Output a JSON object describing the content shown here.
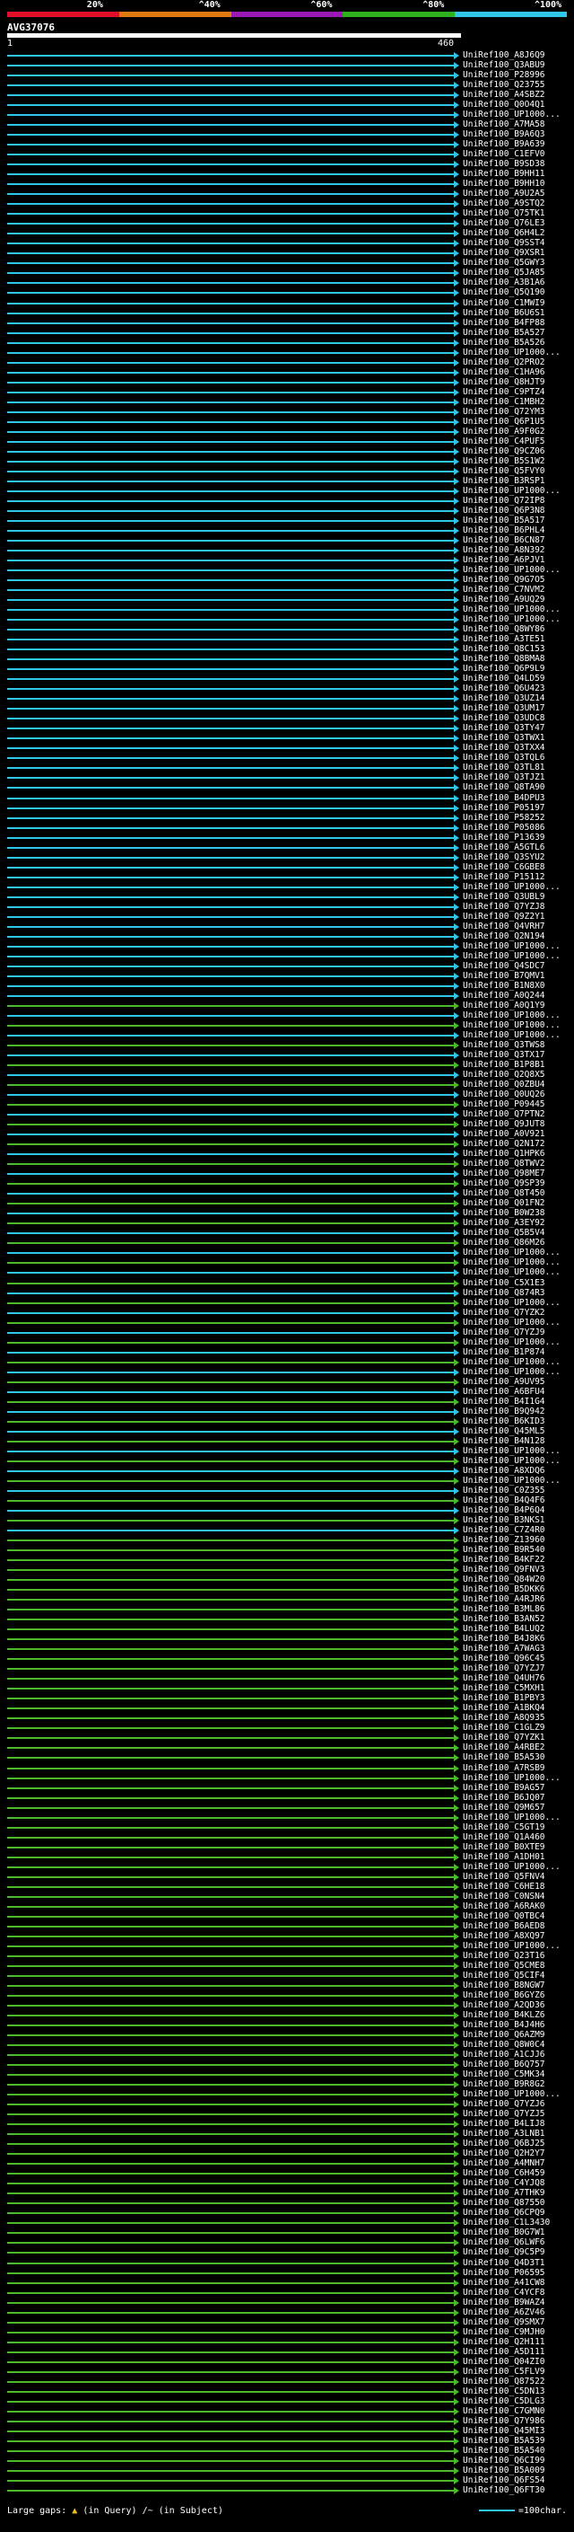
{
  "legend": {
    "labels": [
      "20%",
      "^40%",
      "^60%",
      "^80%",
      "^100%"
    ],
    "colors": [
      "#e0102a",
      "#e07a10",
      "#9a1ab4",
      "#2fb01e",
      "#2fc6e8"
    ]
  },
  "query": {
    "id": "AVG37076",
    "start": "1",
    "end": "460"
  },
  "colors": {
    "high": "#2fc6e8",
    "mid": "#4db82a",
    "low": "#1a3a0a"
  },
  "hits": [
    "UniRef100_A8J6Q9",
    "UniRef100_Q3ABU9",
    "UniRef100_P28996",
    "UniRef100_Q23755",
    "UniRef100_A4SBZ2",
    "UniRef100_Q0O4Q1",
    "UniRef100_UP1000...",
    "UniRef100_A7MA58",
    "UniRef100_B9A6Q3",
    "UniRef100_B9A639",
    "UniRef100_C1EFV0",
    "UniRef100_B9SD38",
    "UniRef100_B9HH11",
    "UniRef100_B9HH10",
    "UniRef100_A9U2A5",
    "UniRef100_A9STQ2",
    "UniRef100_Q75TK1",
    "UniRef100_Q76LE3",
    "UniRef100_Q6H4L2",
    "UniRef100_Q9SST4",
    "UniRef100_Q9XSR1",
    "UniRef100_Q5GWY3",
    "UniRef100_Q5JA85",
    "UniRef100_A3B1A6",
    "UniRef100_Q5Q190",
    "UniRef100_C1MWI9",
    "UniRef100_B6U6S1",
    "UniRef100_B4FP88",
    "UniRef100_B5A527",
    "UniRef100_B5A526",
    "UniRef100_UP1000...",
    "UniRef100_Q2PRO2",
    "UniRef100_C1HA96",
    "UniRef100_Q8HJT9",
    "UniRef100_C9PTZ4",
    "UniRef100_C1MBH2",
    "UniRef100_Q72YM3",
    "UniRef100_Q6P1U5",
    "UniRef100_A9F0G2",
    "UniRef100_C4PUF5",
    "UniRef100_Q9CZ06",
    "UniRef100_B5S1W2",
    "UniRef100_Q5FVY0",
    "UniRef100_B3RSP1",
    "UniRef100_UP1000...",
    "UniRef100_Q72IP8",
    "UniRef100_Q6P3N8",
    "UniRef100_B5A517",
    "UniRef100_B6PHL4",
    "UniRef100_B6CN87",
    "UniRef100_A8N392",
    "UniRef100_A6PJV1",
    "UniRef100_UP1000...",
    "UniRef100_Q9G7O5",
    "UniRef100_C7NVM2",
    "UniRef100_A9UQ29",
    "UniRef100_UP1000...",
    "UniRef100_UP1000...",
    "UniRef100_Q8WY86",
    "UniRef100_A3TE51",
    "UniRef100_Q8C153",
    "UniRef100_Q8BMA8",
    "UniRef100_Q6P9L9",
    "UniRef100_Q4LD59",
    "UniRef100_Q6U423",
    "UniRef100_Q3UZ14",
    "UniRef100_Q3UM17",
    "UniRef100_Q3UDC8",
    "UniRef100_Q3TY47",
    "UniRef100_Q3TWX1",
    "UniRef100_Q3TXX4",
    "UniRef100_Q3TQL6",
    "UniRef100_Q3TL81",
    "UniRef100_Q3TJZ1",
    "UniRef100_Q8TA90",
    "UniRef100_B4DPU3",
    "UniRef100_P05197",
    "UniRef100_P58252",
    "UniRef100_P05086",
    "UniRef100_P13639",
    "UniRef100_A5GTL6",
    "UniRef100_Q3SYU2",
    "UniRef100_C6GBE8",
    "UniRef100_P15112",
    "UniRef100_UP1000...",
    "UniRef100_Q3UBL9",
    "UniRef100_Q7YZJ8",
    "UniRef100_Q9Z2Y1",
    "UniRef100_Q4VRH7",
    "UniRef100_Q2N194",
    "UniRef100_UP1000...",
    "UniRef100_UP1000...",
    "UniRef100_Q4SDC7",
    "UniRef100_B7QMV1",
    "UniRef100_B1N8X0",
    "UniRef100_A0Q244",
    "UniRef100_A0Q1Y9",
    "UniRef100_UP1000...",
    "UniRef100_UP1000...",
    "UniRef100_UP1000...",
    "UniRef100_Q3TWS8",
    "UniRef100_Q3TX17",
    "UniRef100_B1P8B1",
    "UniRef100_Q2Q8X5",
    "UniRef100_Q0ZBU4",
    "UniRef100_Q0UQ26",
    "UniRef100_P09445",
    "UniRef100_Q7PTN2",
    "UniRef100_Q9JUT8",
    "UniRef100_A0V921",
    "UniRef100_Q2N172",
    "UniRef100_Q1HPK6",
    "UniRef100_Q8TWV2",
    "UniRef100_Q98ME7",
    "UniRef100_Q9SP39",
    "UniRef100_Q8T450",
    "UniRef100_Q01FN2",
    "UniRef100_B0W238",
    "UniRef100_A3EY92",
    "UniRef100_Q5B5V4",
    "UniRef100_Q86M26",
    "UniRef100_UP1000...",
    "UniRef100_UP1000...",
    "UniRef100_UP1000...",
    "UniRef100_C5X1E3",
    "UniRef100_Q874R3",
    "UniRef100_UP1000...",
    "UniRef100_Q7YZK2",
    "UniRef100_UP1000...",
    "UniRef100_Q7YZJ9",
    "UniRef100_UP1000...",
    "UniRef100_B1P874",
    "UniRef100_UP1000...",
    "UniRef100_UP1000...",
    "UniRef100_A9UV95",
    "UniRef100_A6BFU4",
    "UniRef100_B4I1G4",
    "UniRef100_B9Q942",
    "UniRef100_B6KID3",
    "UniRef100_Q45ML5",
    "UniRef100_B4N128",
    "UniRef100_UP1000...",
    "UniRef100_UP1000...",
    "UniRef100_A8XDQ6",
    "UniRef100_UP1000...",
    "UniRef100_C0Z355",
    "UniRef100_B4Q4F6",
    "UniRef100_B4P6Q4",
    "UniRef100_B3NKS1",
    "UniRef100_C7Z4R0",
    "UniRef100_Z13960",
    "UniRef100_B9R540",
    "UniRef100_B4KF22",
    "UniRef100_Q9FNV3",
    "UniRef100_Q84W20",
    "UniRef100_B5DKK6",
    "UniRef100_A4RJR6",
    "UniRef100_B3ML86",
    "UniRef100_B3AN52",
    "UniRef100_B4LUQ2",
    "UniRef100_B4J8K6",
    "UniRef100_A7WAG3",
    "UniRef100_Q96C45",
    "UniRef100_Q7YZJ7",
    "UniRef100_Q4UH76",
    "UniRef100_C5MXH1",
    "UniRef100_B1PBY3",
    "UniRef100_A1BKQ4",
    "UniRef100_A8Q935",
    "UniRef100_C1GLZ9",
    "UniRef100_Q7YZK1",
    "UniRef100_A4RBE2",
    "UniRef100_B5A530",
    "UniRef100_A7RSB9",
    "UniRef100_UP1000...",
    "UniRef100_B9AG57",
    "UniRef100_B6JQ07",
    "UniRef100_Q9M657",
    "UniRef100_UP1000...",
    "UniRef100_C5GT19",
    "UniRef100_Q1A460",
    "UniRef100_B0XTE9",
    "UniRef100_A1DH01",
    "UniRef100_UP1000...",
    "UniRef100_Q5FNV4",
    "UniRef100_C6HE18",
    "UniRef100_C0NSN4",
    "UniRef100_A6RAK0",
    "UniRef100_Q0TBC4",
    "UniRef100_B6AED8",
    "UniRef100_A8XQ97",
    "UniRef100_UP1000...",
    "UniRef100_Q23T16",
    "UniRef100_Q5CME8",
    "UniRef100_Q5CIF4",
    "UniRef100_B8NGW7",
    "UniRef100_B6GYZ6",
    "UniRef100_A2QD36",
    "UniRef100_B4KLZ6",
    "UniRef100_B4J4H6",
    "UniRef100_Q6AZM9",
    "UniRef100_Q8W0C4",
    "UniRef100_A1CJJ6",
    "UniRef100_B6Q757",
    "UniRef100_C5MK34",
    "UniRef100_B9R8G2",
    "UniRef100_UP1000...",
    "UniRef100_Q7YZJ6",
    "UniRef100_Q7YZJ5",
    "UniRef100_B4LIJ8",
    "UniRef100_A3LNB1",
    "UniRef100_Q6BJ25",
    "UniRef100_Q2H2Y7",
    "UniRef100_A4MNH7",
    "UniRef100_C6H459",
    "UniRef100_C4YJQ8",
    "UniRef100_A7THK9",
    "UniRef100_Q87550",
    "UniRef100_Q6CPQ9",
    "UniRef100_C1L3430",
    "UniRef100_B0G7W1",
    "UniRef100_Q6LWF6",
    "UniRef100_Q9C5P9",
    "UniRef100_Q4D3T1",
    "UniRef100_P06595",
    "UniRef100_A41CW8",
    "UniRef100_C4YCF8",
    "UniRef100_B9WAZ4",
    "UniRef100_A6ZV46",
    "UniRef100_Q9SMX7",
    "UniRef100_C9MJH0",
    "UniRef100_Q2H111",
    "UniRef100_A5D111",
    "UniRef100_Q04ZI0",
    "UniRef100_C5FLV9",
    "UniRef100_Q87522",
    "UniRef100_C5DN13",
    "UniRef100_C5DLG3",
    "UniRef100_C7GMN0",
    "UniRef100_Q7Y986",
    "UniRef100_Q45MI3",
    "UniRef100_B5A539",
    "UniRef100_B5A540",
    "UniRef100_Q6CI99",
    "UniRef100_B5A009",
    "UniRef100_Q6FS54",
    "UniRef100_Q6FT30"
  ],
  "footer": {
    "large_gaps": "Large gaps:",
    "in_query": "(in Query)",
    "in_subject": "/~ (in Subject)",
    "scale": "=100char."
  }
}
